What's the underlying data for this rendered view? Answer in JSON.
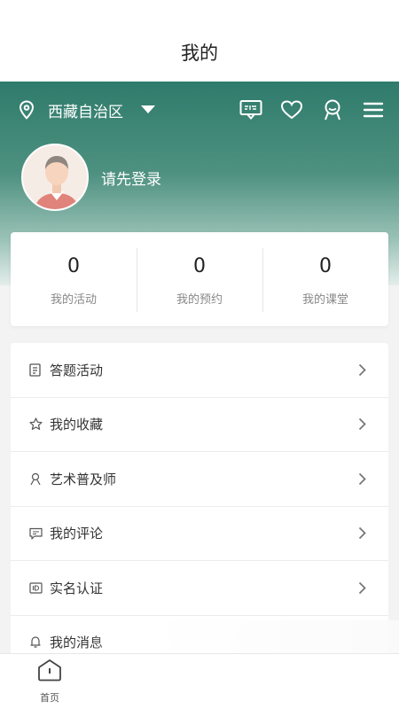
{
  "header": {
    "title": "我的"
  },
  "location": {
    "region": "西藏自治区"
  },
  "topbar_icons": [
    "chat-icon",
    "heart-icon",
    "user-badge-icon",
    "menu-icon"
  ],
  "profile": {
    "login_prompt": "请先登录"
  },
  "stats": [
    {
      "value": "0",
      "label": "我的活动"
    },
    {
      "value": "0",
      "label": "我的预约"
    },
    {
      "value": "0",
      "label": "我的课堂"
    }
  ],
  "menu": [
    {
      "label": "答题活动",
      "icon": "quiz-icon"
    },
    {
      "label": "我的收藏",
      "icon": "star-icon"
    },
    {
      "label": "艺术普及师",
      "icon": "person-icon"
    },
    {
      "label": "我的评论",
      "icon": "comment-icon"
    },
    {
      "label": "实名认证",
      "icon": "id-card-icon"
    },
    {
      "label": "我的消息",
      "icon": "bell-icon"
    }
  ],
  "tabbar": {
    "home_label": "首页"
  },
  "colors": {
    "accent": "#2f7b6c",
    "background": "#f3f3f3"
  }
}
